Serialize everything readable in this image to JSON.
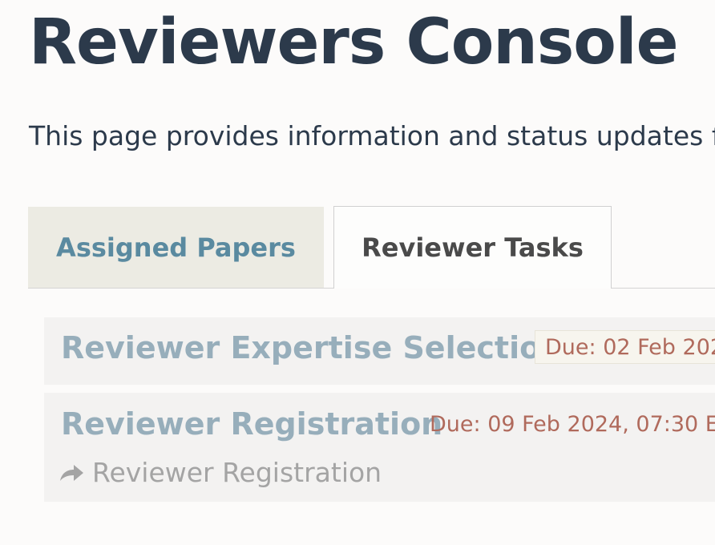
{
  "header": {
    "title": "Reviewers Console",
    "intro": "This page provides information and status updates f"
  },
  "tabs": [
    {
      "label": "Assigned Papers",
      "active": false
    },
    {
      "label": "Reviewer Tasks",
      "active": true
    }
  ],
  "tasks": [
    {
      "title": "Reviewer Expertise Selection",
      "due": "Due: 02 Feb 202"
    },
    {
      "title": "Reviewer Registration",
      "due": "Due: 09 Feb 2024, 07:30 E",
      "subtask": {
        "icon": "share-arrow-icon",
        "label": "Reviewer Registration"
      }
    }
  ],
  "colors": {
    "title": "#2c3a4b",
    "tab_inactive_bg": "#ecebe3",
    "tab_inactive_text": "#5a8aa0",
    "task_title": "#97aebb",
    "due_text": "#b06a5c"
  }
}
